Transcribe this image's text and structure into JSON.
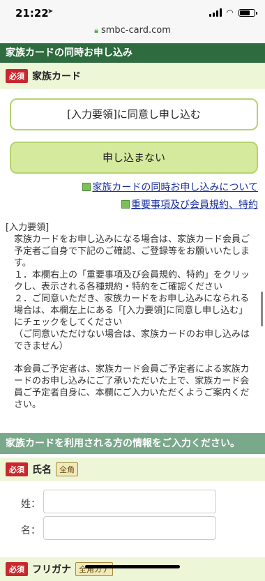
{
  "status": {
    "time": "21:22",
    "location_icon": "location-arrow-icon"
  },
  "browser": {
    "url": "smbc-card.com"
  },
  "header": {
    "title": "家族カードの同時お申し込み"
  },
  "card_section": {
    "required_badge": "必須",
    "title": "家族カード"
  },
  "buttons": {
    "agree": "[入力要領]に同意し申し込む",
    "decline": "申し込まない"
  },
  "links": {
    "family_card_about": "家族カードの同時お申し込みについて",
    "terms": "重要事項及び会員規約、特約"
  },
  "notice": {
    "title": "[入力要領]",
    "lead": "家族カードをお申し込みになる場合は、家族カード会員ご予定者ご自身で下記のご確認、ご登録等をお願いいたします。",
    "item1": "１．本欄右上の「重要事項及び会員規約、特約」をクリックし、表示される各種規約・特約をご確認ください",
    "item2": "２．ご同意いただき、家族カードをお申し込みになられる場合は、本欄左上にある「[入力要領]に同意し申し込む」にチェックをしてください",
    "item2_note": "（ご同意いただけない場合は、家族カードのお申し込みはできません）",
    "closing": "本会員ご予定者は、家族カード会員ご予定者による家族カードのお申し込みにご了承いただいた上で、家族カード会員ご予定者自身に、本欄にご入力いただくようご案内ください。"
  },
  "user_info": {
    "heading": "家族カードを利用される方の情報をご入力ください。"
  },
  "name_field": {
    "required_badge": "必須",
    "label": "氏名",
    "width_badge": "全角",
    "last_name_label": "姓：",
    "last_name_value": "",
    "first_name_label": "名：",
    "first_name_value": ""
  },
  "furigana_field": {
    "required_badge": "必須",
    "label": "フリガナ",
    "width_badge": "全角カナ"
  }
}
